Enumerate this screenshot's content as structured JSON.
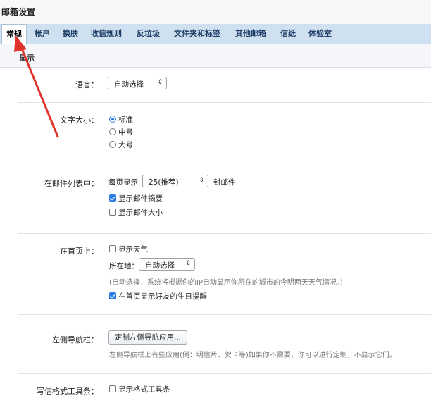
{
  "window": {
    "title": "邮箱设置"
  },
  "tabs": [
    {
      "label": "常规",
      "active": true
    },
    {
      "label": "帐户"
    },
    {
      "label": "换肤"
    },
    {
      "label": "收信规则"
    },
    {
      "label": "反垃圾"
    },
    {
      "label": "文件夹和标签"
    },
    {
      "label": "其他邮箱"
    },
    {
      "label": "信纸"
    },
    {
      "label": "体验室"
    }
  ],
  "section": {
    "label": "显示"
  },
  "language": {
    "label": "语言：",
    "select_value": "自动选择"
  },
  "font_size": {
    "label": "文字大小：",
    "options": [
      {
        "label": "标准",
        "checked": true
      },
      {
        "label": "中号",
        "checked": false
      },
      {
        "label": "大号",
        "checked": false
      }
    ]
  },
  "mail_list": {
    "label": "在邮件列表中：",
    "per_page_prefix": "每页显示",
    "per_page_value": "25(推荐)",
    "per_page_suffix": "封邮件",
    "show_summary": {
      "label": "显示邮件摘要",
      "checked": true
    },
    "show_size": {
      "label": "显示邮件大小",
      "checked": false
    }
  },
  "home_page": {
    "label": "在首页上：",
    "show_weather": {
      "label": "显示天气",
      "checked": false
    },
    "location_label": "所在地：",
    "location_value": "自动选择",
    "hint": "(自动选择，系统将根据你的IP自动显示你所在的城市的今明两天天气情况。)",
    "show_birthday": {
      "label": "在首页显示好友的生日提醒",
      "checked": true
    }
  },
  "left_nav": {
    "label": "左侧导航栏：",
    "button_label": "定制左侧导航应用...",
    "hint": "左侧导航栏上有些应用(例：明信片、贺卡等)如果你不需要，你可以进行定制，不显示它们。"
  },
  "compose_toolbar": {
    "label": "写信格式工具条：",
    "show_toolbar": {
      "label": "显示格式工具条",
      "checked": false
    }
  },
  "annotation": {
    "color": "#e0332b"
  }
}
